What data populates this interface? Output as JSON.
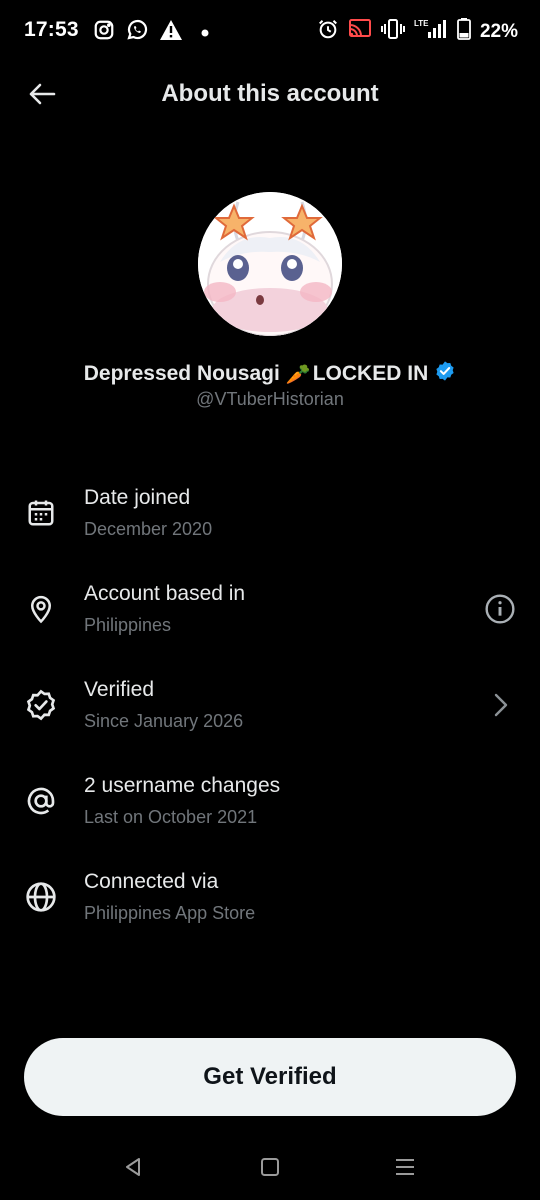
{
  "status_bar": {
    "time": "17:53",
    "battery": "22%",
    "left_icons": [
      "instagram-icon",
      "whatsapp-icon",
      "warning-icon",
      "dot-icon"
    ],
    "right_icons": [
      "alarm-icon",
      "cast-icon",
      "vibrate-icon",
      "lte-signal-icon",
      "battery-icon"
    ]
  },
  "header": {
    "title": "About this account"
  },
  "profile": {
    "display_name": "Depressed Nousagi",
    "display_name_emoji": "🥕",
    "display_name_suffix": "LOCKED IN",
    "handle": "@VTuberHistorian",
    "verified_badge_color": "#1d9bf0"
  },
  "info": [
    {
      "icon": "calendar-icon",
      "title": "Date joined",
      "subtitle": "December 2020"
    },
    {
      "icon": "location-pin-icon",
      "title": "Account based in",
      "subtitle": "Philippines",
      "trailing": "info-icon"
    },
    {
      "icon": "verified-badge-icon",
      "title": "Verified",
      "subtitle": "Since January 2026",
      "trailing": "chevron-right-icon"
    },
    {
      "icon": "at-sign-icon",
      "title": "2 username changes",
      "subtitle": "Last on October 2021"
    },
    {
      "icon": "globe-icon",
      "title": "Connected via",
      "subtitle": "Philippines App Store"
    }
  ],
  "cta": {
    "label": "Get Verified"
  },
  "colors": {
    "background": "#000000",
    "primary_text": "#e7e9ea",
    "secondary_text": "#71767b",
    "button_bg": "#eff3f4",
    "button_text": "#0f1419",
    "accent": "#1d9bf0"
  }
}
